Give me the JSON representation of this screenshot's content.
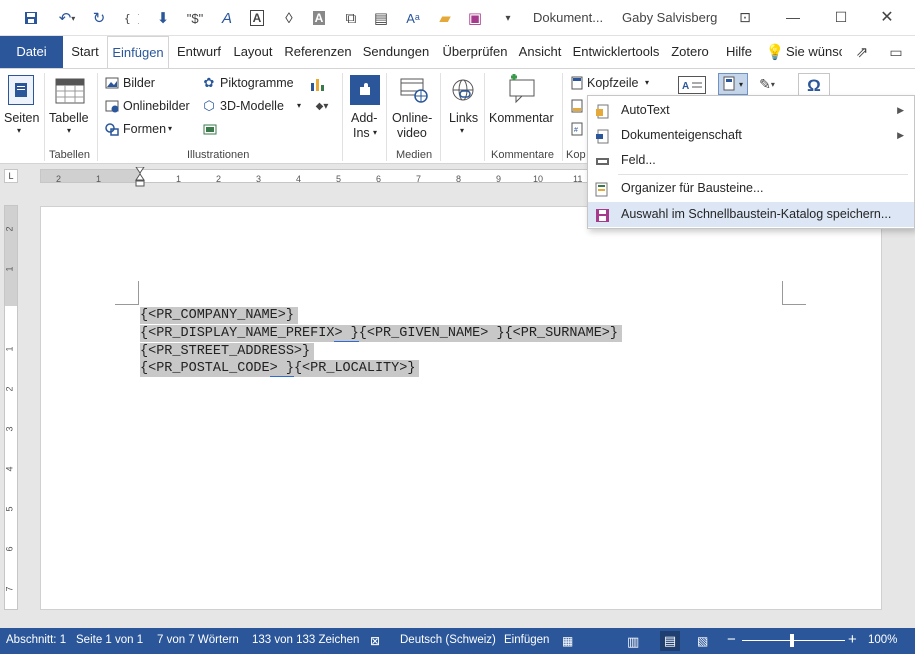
{
  "titlebar": {
    "doc_title": "Dokument...",
    "user_name": "Gaby Salvisberg"
  },
  "tabs": [
    "Datei",
    "Start",
    "Einfügen",
    "Entwurf",
    "Layout",
    "Referenzen",
    "Sendungen",
    "Überprüfen",
    "Ansicht",
    "Entwicklertools",
    "Zotero",
    "Hilfe"
  ],
  "tell_me": "Sie wünsc",
  "ribbon": {
    "pages": "Seiten",
    "table": "Tabelle",
    "group_tables": "Tabellen",
    "pictures": "Bilder",
    "online_pictures": "Onlinebilder",
    "shapes": "Formen",
    "icons": "Piktogramme",
    "models3d": "3D-Modelle",
    "group_illustrations": "Illustrationen",
    "addins_1": "Add-",
    "addins_2": "Ins",
    "online_video_1": "Online-",
    "online_video_2": "video",
    "group_media": "Medien",
    "links": "Links",
    "comment": "Kommentar",
    "group_comments": "Kommentare",
    "header": "Kopfzeile",
    "group_header_partial": "Kop"
  },
  "dropdown": {
    "items": [
      "AutoText",
      "Dokumenteigenschaft",
      "Feld...",
      "Organizer für Bausteine...",
      "Auswahl im Schnellbaustein-Katalog speichern..."
    ]
  },
  "ruler": {
    "h_ticks": [
      "2",
      "1",
      "1",
      "2",
      "3",
      "4",
      "5",
      "6",
      "7",
      "8",
      "9",
      "10",
      "11"
    ],
    "v_ticks": [
      "2",
      "1",
      "1",
      "2",
      "3",
      "4",
      "5",
      "6",
      "7"
    ]
  },
  "document": {
    "line1": "{<PR_COMPANY_NAME>}",
    "line2a": "{<PR_DISPLAY_NAME_PREFIX",
    "line2b": "> }",
    "line2c": "{<PR_GIVEN_NAME> }{<PR_SURNAME>}",
    "line3": "{<PR_STREET_ADDRESS>}",
    "line4a": "{<PR_POSTAL_CODE",
    "line4b": "> }",
    "line4c": "{<PR_LOCALITY>}"
  },
  "status": {
    "section": "Abschnitt: 1",
    "page": "Seite 1 von 1",
    "words": "7 von 7 Wörtern",
    "chars": "133 von 133 Zeichen",
    "language": "Deutsch (Schweiz)",
    "mode": "Einfügen",
    "zoom": "100%"
  },
  "colors": {
    "accent": "#2b579a",
    "selection": "#c8c8c8",
    "menu_highlight": "#dce6f4"
  }
}
